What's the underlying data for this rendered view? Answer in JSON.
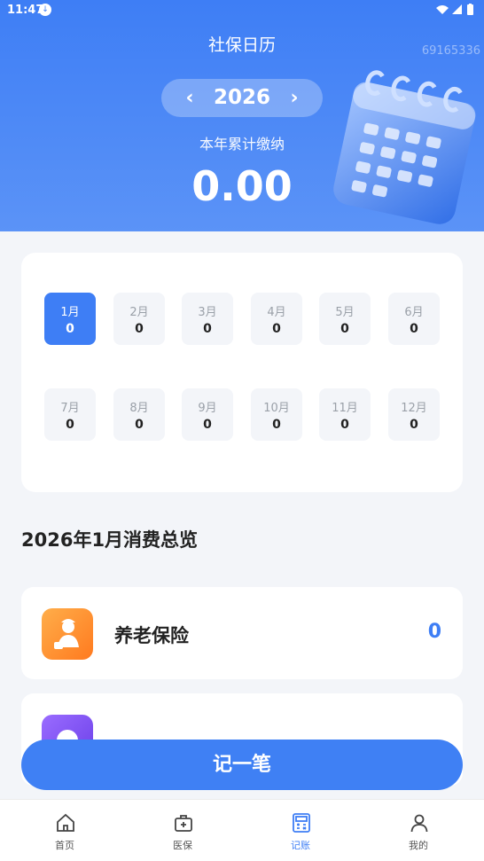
{
  "status": {
    "time": "11:47"
  },
  "header": {
    "title": "社保日历",
    "watermark": "69165336",
    "year": "2026",
    "prev_icon": "chevron-left-icon",
    "next_icon": "chevron-right-icon",
    "total_label": "本年累计缴纳",
    "total_value": "0.00"
  },
  "months": [
    {
      "label": "1月",
      "amount": "0",
      "active": true
    },
    {
      "label": "2月",
      "amount": "0"
    },
    {
      "label": "3月",
      "amount": "0"
    },
    {
      "label": "4月",
      "amount": "0"
    },
    {
      "label": "5月",
      "amount": "0"
    },
    {
      "label": "6月",
      "amount": "0"
    },
    {
      "label": "7月",
      "amount": "0"
    },
    {
      "label": "8月",
      "amount": "0"
    },
    {
      "label": "9月",
      "amount": "0"
    },
    {
      "label": "10月",
      "amount": "0"
    },
    {
      "label": "11月",
      "amount": "0"
    },
    {
      "label": "12月",
      "amount": "0"
    }
  ],
  "overview": {
    "title": "2026年1月消费总览",
    "items": [
      {
        "label": "养老保险",
        "value": "0",
        "icon": "pension-worker-icon",
        "color": "#ff8a2a"
      },
      {
        "icon": "insurance-icon",
        "color": "#7a4df0"
      }
    ]
  },
  "record_button": {
    "label": "记一笔"
  },
  "nav": [
    {
      "label": "首页",
      "icon": "home-icon"
    },
    {
      "label": "医保",
      "icon": "medical-kit-icon"
    },
    {
      "label": "记账",
      "icon": "calculator-icon",
      "active": true
    },
    {
      "label": "我的",
      "icon": "user-icon"
    }
  ],
  "colors": {
    "accent": "#3e7ef5",
    "background": "#f3f5f9"
  }
}
